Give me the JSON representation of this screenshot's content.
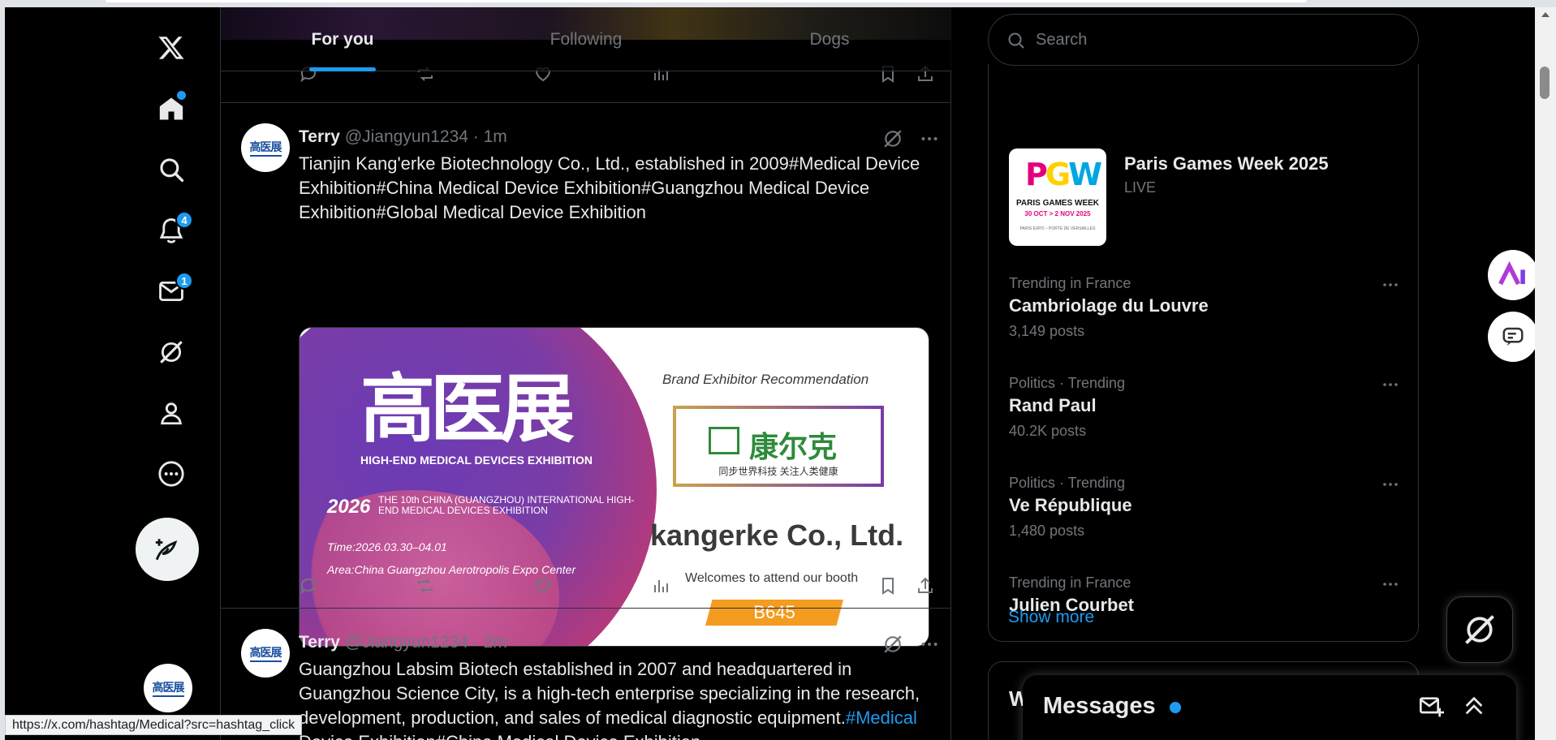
{
  "status_url": "https://x.com/hashtag/Medical?src=hashtag_click",
  "nav": {
    "notifications_badge": "4",
    "messages_badge": "1"
  },
  "tabs": [
    {
      "label": "For you"
    },
    {
      "label": "Following"
    },
    {
      "label": "Dogs"
    }
  ],
  "tweets": [
    {
      "name": "Terry",
      "handle": "@Jiangyun1234",
      "time": "· 1m",
      "text": "Tianjin Kang'erke Biotechnology Co., Ltd., established in 2009#Medical Device Exhibition#China Medical Device Exhibition#Guangzhou Medical Device Exhibition#Global Medical Device Exhibition",
      "media": {
        "logo": "高医展",
        "subtitle": "HIGH-END MEDICAL DEVICES EXHIBITION",
        "year": "2026",
        "event": "THE 10th CHINA (GUANGZHOU) INTERNATIONAL HIGH-END MEDICAL DEVICES EXHIBITION",
        "time": "Time:2026.03.30–04.01",
        "area": "Area:China Guangzhou Aerotropolis Expo Center",
        "brand_rec": "Brand Exhibitor Recommendation",
        "brand_cn": "康尔克",
        "brand_tagline": "同步世界科技  关注人类健康",
        "company": "kangerke Co., Ltd.",
        "welcome": "Welcomes to attend our booth",
        "booth": "B645"
      }
    },
    {
      "name": "Terry",
      "handle": "@Jiangyun1234",
      "time": "· 2m",
      "text_before": "Guangzhou Labsim Biotech established in 2007 and headquartered in Guangzhou Science City, is a high-tech enterprise specializing in the research, development, production, and sales of medical diagnostic equipment.",
      "text_link": "#Medical",
      "text_after": " Device Exhibition#China Medical Device Exhibition"
    }
  ],
  "search": {
    "placeholder": "Search"
  },
  "event": {
    "title": "Paris Games Week 2025",
    "status": "LIVE",
    "logo": "PGW",
    "poster_title": "PARIS GAMES WEEK",
    "poster_dates": "30 OCT > 2 NOV 2025",
    "poster_small": "PARIS EXPO – PORTE DE VERSAILLES"
  },
  "trends": [
    {
      "context": "Trending in France",
      "name": "Cambriolage du Louvre",
      "posts": "3,149 posts"
    },
    {
      "context": "Politics · Trending",
      "name": "Rand Paul",
      "posts": "40.2K posts"
    },
    {
      "context": "Politics · Trending",
      "name": "Ve République",
      "posts": "1,480 posts"
    },
    {
      "context": "Trending in France",
      "name": "Julien Courbet",
      "posts": ""
    }
  ],
  "show_more": "Show more",
  "next_card_initial": "W",
  "messages": {
    "title": "Messages"
  },
  "avatar_logo": "高医展",
  "colors": {
    "accent": "#1d9bf0",
    "background": "#000000",
    "border": "#2f3336",
    "muted": "#71767b"
  }
}
